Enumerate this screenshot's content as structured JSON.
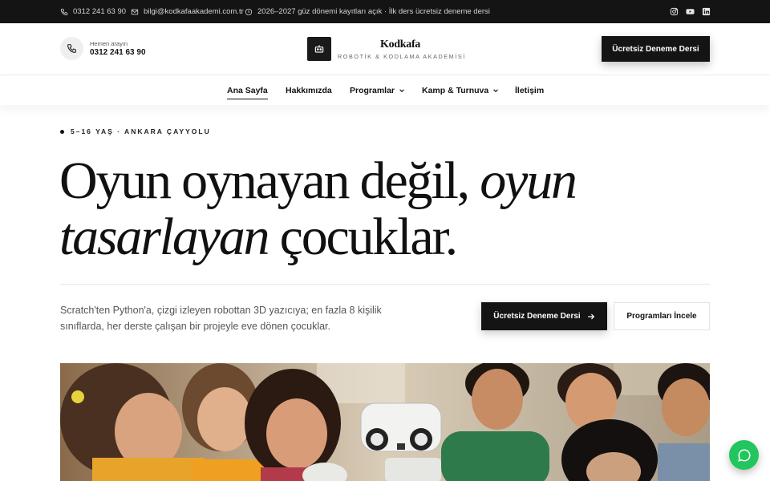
{
  "topbar": {
    "phone": "0312 241 63 90",
    "email": "bilgi@kodkafaakademi.com.tr",
    "notice": "2026–2027 güz dönemi kayıtları açık · İlk ders ücretsiz deneme dersi",
    "icons": [
      "phone-icon",
      "mail-icon",
      "clock-icon",
      "instagram-icon",
      "youtube-icon",
      "linkedin-icon"
    ]
  },
  "header": {
    "call_label": "Hemen arayın",
    "call_number": "0312 241 63 90",
    "brand": "Kodkafa",
    "tagline": "ROBOTİK & KODLAMA AKADEMİSİ",
    "cta": "Ücretsiz Deneme Dersi"
  },
  "nav": {
    "items": [
      {
        "label": "Ana Sayfa"
      },
      {
        "label": "Hakkımızda"
      },
      {
        "label": "Programlar"
      },
      {
        "label": "Kamp & Turnuva"
      },
      {
        "label": "İletişim"
      }
    ]
  },
  "hero": {
    "eyebrow": "5–16 YAŞ · ANKARA ÇAYYOLU",
    "headline_1a": "Oyun oynayan değil, ",
    "headline_1b": "oyun",
    "headline_2a": "tasarlayan",
    "headline_2b": " çocuklar.",
    "lead": "Scratch'ten Python'a, çizgi izleyen robottan 3D yazıcıya; en fazla 8 kişilik sınıflarda, her derste çalışan bir projeyle eve dönen çocuklar.",
    "primary_cta": "Ücretsiz Deneme Dersi",
    "secondary_cta": "Programları İncele"
  },
  "colors": {
    "dark": "#141414",
    "whatsapp": "#22c55e"
  }
}
